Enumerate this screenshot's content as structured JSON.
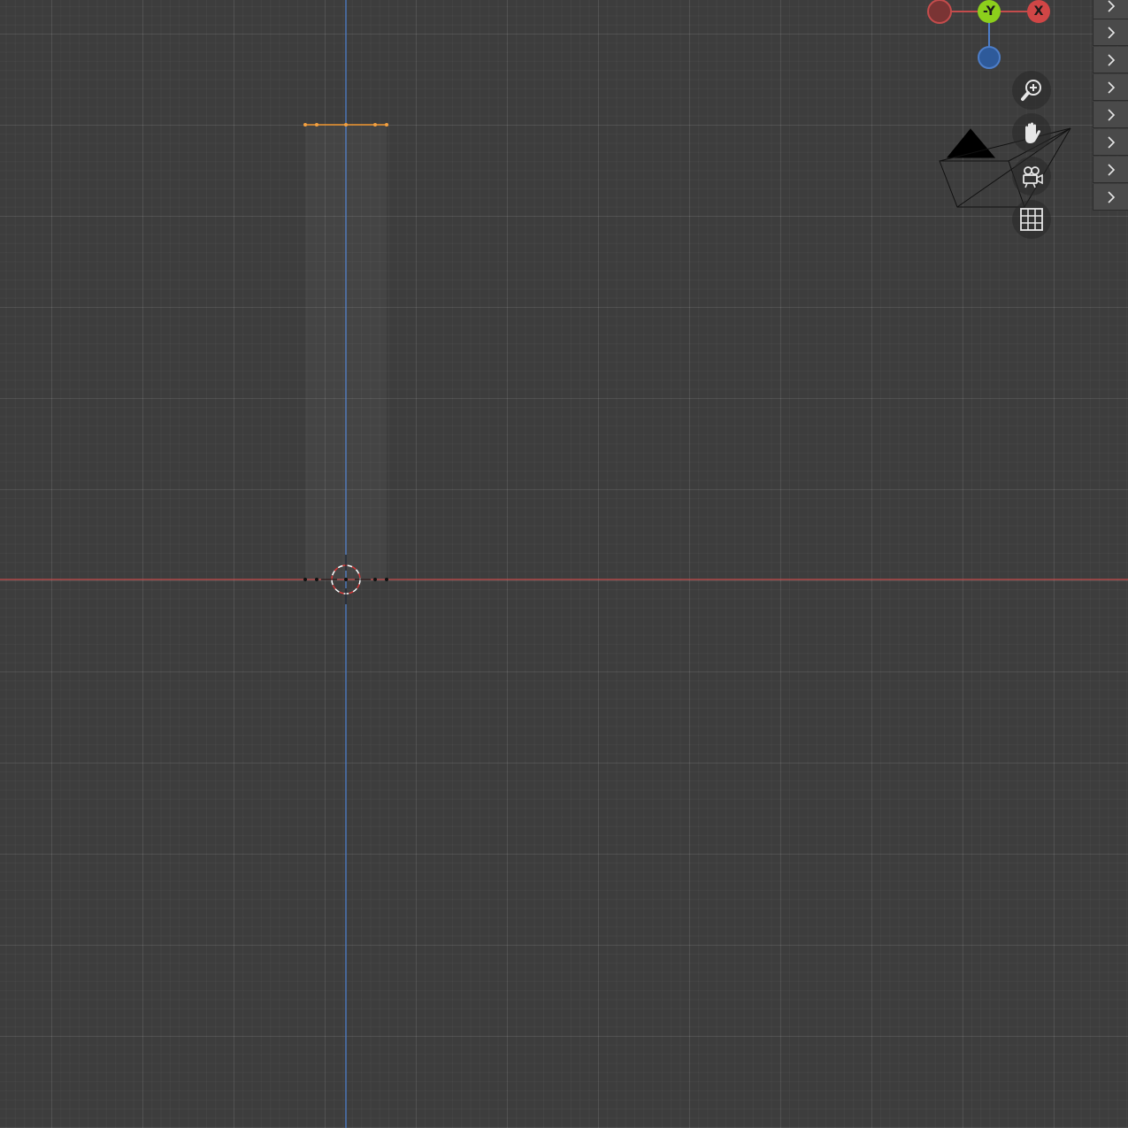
{
  "viewport": {
    "background_color": "#3d3d3d",
    "x_axis_color": "#c84b4b",
    "z_axis_color": "#4d7ec9",
    "mesh_color": "#f0952e"
  },
  "gizmo": {
    "axes": [
      {
        "name": "x-negative",
        "label": "",
        "color": "#c44c4c"
      },
      {
        "name": "y-negative",
        "label": "-Y",
        "color": "#8ccf1c"
      },
      {
        "name": "x-positive",
        "label": "X",
        "color": "#d04646"
      },
      {
        "name": "z-negative",
        "label": "",
        "color": "#3f6fb5"
      }
    ]
  },
  "nav_controls": [
    {
      "name": "zoom-icon",
      "action": "zoom"
    },
    {
      "name": "hand-pan-icon",
      "action": "pan"
    },
    {
      "name": "camera-view-icon",
      "action": "camera"
    },
    {
      "name": "grid-ortho-icon",
      "action": "toggle-perspective"
    }
  ],
  "sidebar_tabs": [
    {
      "icon": "chevron-right-icon"
    },
    {
      "icon": "chevron-right-icon"
    },
    {
      "icon": "chevron-right-icon"
    },
    {
      "icon": "chevron-right-icon"
    },
    {
      "icon": "chevron-right-icon"
    },
    {
      "icon": "chevron-right-icon"
    },
    {
      "icon": "chevron-right-icon"
    },
    {
      "icon": "chevron-right-icon"
    }
  ]
}
